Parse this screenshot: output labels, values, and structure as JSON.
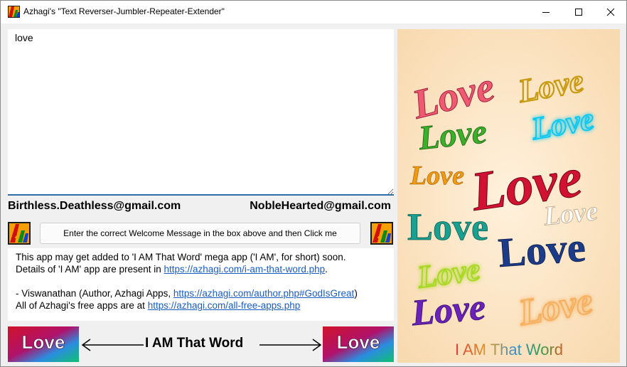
{
  "window": {
    "title": "Azhagi's \"Text Reverser-Jumbler-Repeater-Extender\"",
    "min_icon": "minimize-icon",
    "max_icon": "maximize-icon",
    "close_icon": "close-icon"
  },
  "input": {
    "value": "love"
  },
  "emails": {
    "left": "Birthless.Deathless@gmail.com",
    "right": "NobleHearted@gmail.com"
  },
  "action": {
    "welcome_label": "Enter the correct Welcome Message in the box above and then Click me"
  },
  "info": {
    "line1": "This app may get added to 'I AM That Word' mega app ('I AM', for short) soon.",
    "line2_prefix": "Details of 'I AM' app are present in ",
    "line2_link": "https://azhagi.com/i-am-that-word.php",
    "line2_suffix": ".",
    "line4_prefix": "- Viswanathan (Author, Azhagi Apps, ",
    "line4_link": "https://azhagi.com/author.php#GodIsGreat",
    "line4_suffix": ")",
    "line5_prefix": "All of Azhagi's free apps are at ",
    "line5_link": "https://azhagi.com/all-free-apps.php"
  },
  "banner": {
    "tile_text": "Love",
    "center_text": "I AM That Word"
  },
  "poster": {
    "words": [
      "Love",
      "Love",
      "Love",
      "Love",
      "Love",
      "Love",
      "Love",
      "Love",
      "Love",
      "Love",
      "Love",
      "Love"
    ],
    "caption": "I AM That Word"
  },
  "colors": {
    "accent_line": "#2e6fa8",
    "link": "#1a5cc4",
    "poster_bg": "#fbe3c0"
  }
}
